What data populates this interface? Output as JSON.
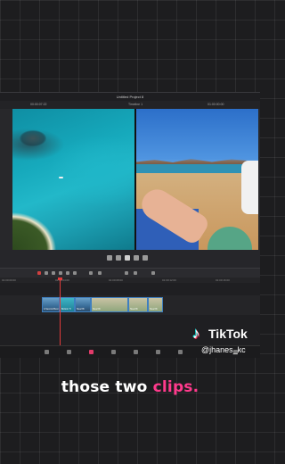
{
  "app": {
    "window_title": "Untitled Project 8",
    "timecode_left": "00:00:07:22",
    "timeline_name": "Timeline 1",
    "timecode_right": "01:00:00:00"
  },
  "ruler": {
    "ticks": [
      "01:00:00:00",
      "01:00:04:00",
      "01:00:08:00",
      "01:00:12:00",
      "01:00:16:00"
    ]
  },
  "clips": [
    {
      "label": "A Second Best"
    },
    {
      "label": "Bottom Tr"
    },
    {
      "label": "Steel Bi"
    },
    {
      "label": "Steel Bi"
    },
    {
      "label": "Steel Bi"
    },
    {
      "label": "Steel Bi"
    }
  ],
  "overlay": {
    "brand": "TikTok",
    "handle": "@jhanes_kc",
    "caption_plain": "those two ",
    "caption_highlight": "clips."
  },
  "colors": {
    "caption_highlight": "#ff3a8c",
    "playhead": "#e23b3b",
    "clip_border": "#3f7fbf"
  },
  "icons": [
    "play-icon",
    "stop-icon",
    "rewind-icon",
    "forward-icon",
    "loop-icon",
    "blade-icon",
    "snap-icon",
    "link-icon",
    "tiktok-logo-icon"
  ]
}
